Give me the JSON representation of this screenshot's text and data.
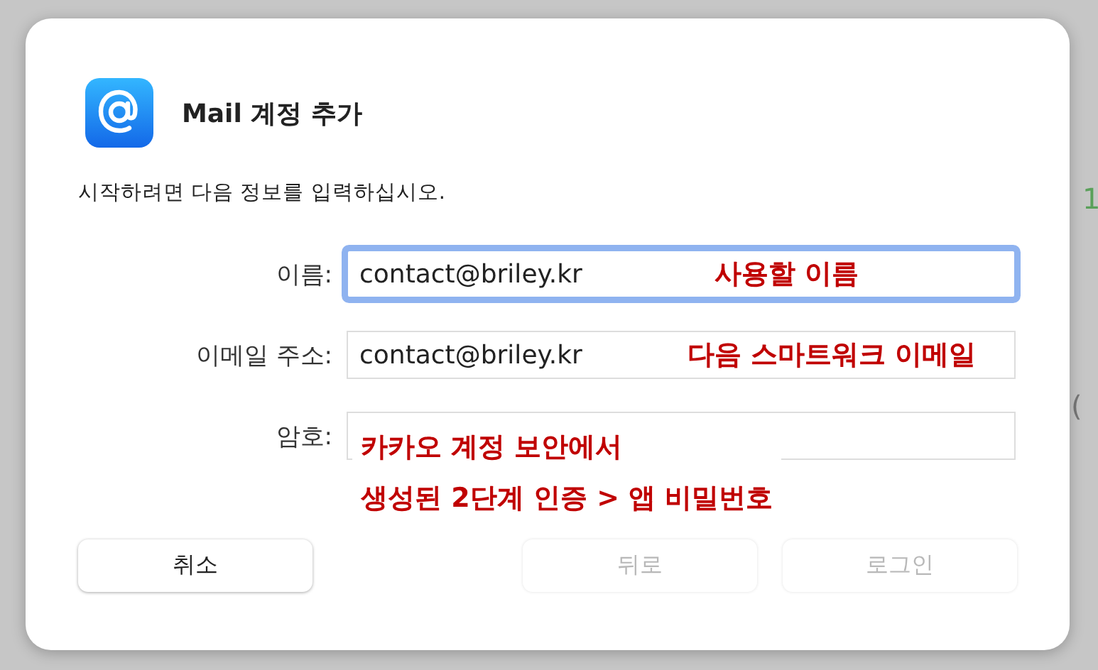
{
  "background_fragments": [
    {
      "text": "1",
      "color": "#5aa05a"
    },
    {
      "text": "(",
      "color": "#777777"
    }
  ],
  "dialog": {
    "title": "Mail 계정 추가",
    "instruction": "시작하려면 다음 정보를 입력하십시오.",
    "fields": [
      {
        "label": "이름:",
        "value": "contact@briley.kr",
        "focused": true
      },
      {
        "label": "이메일 주소:",
        "value": "contact@briley.kr",
        "focused": false
      },
      {
        "label": "암호:",
        "focused": false
      }
    ],
    "buttons": [
      {
        "label": "취소",
        "disabled": false
      },
      {
        "label": "뒤로",
        "disabled": true
      },
      {
        "label": "로그인",
        "disabled": true
      }
    ]
  },
  "annotations": [
    {
      "lines": [
        "사용할 이름"
      ]
    },
    {
      "lines": [
        "다음 스마트워크 이메일"
      ]
    },
    {
      "lines": [
        "카카오 계정 보안에서",
        "생성된 2단계 인증 > 앱 비밀번호"
      ]
    }
  ]
}
